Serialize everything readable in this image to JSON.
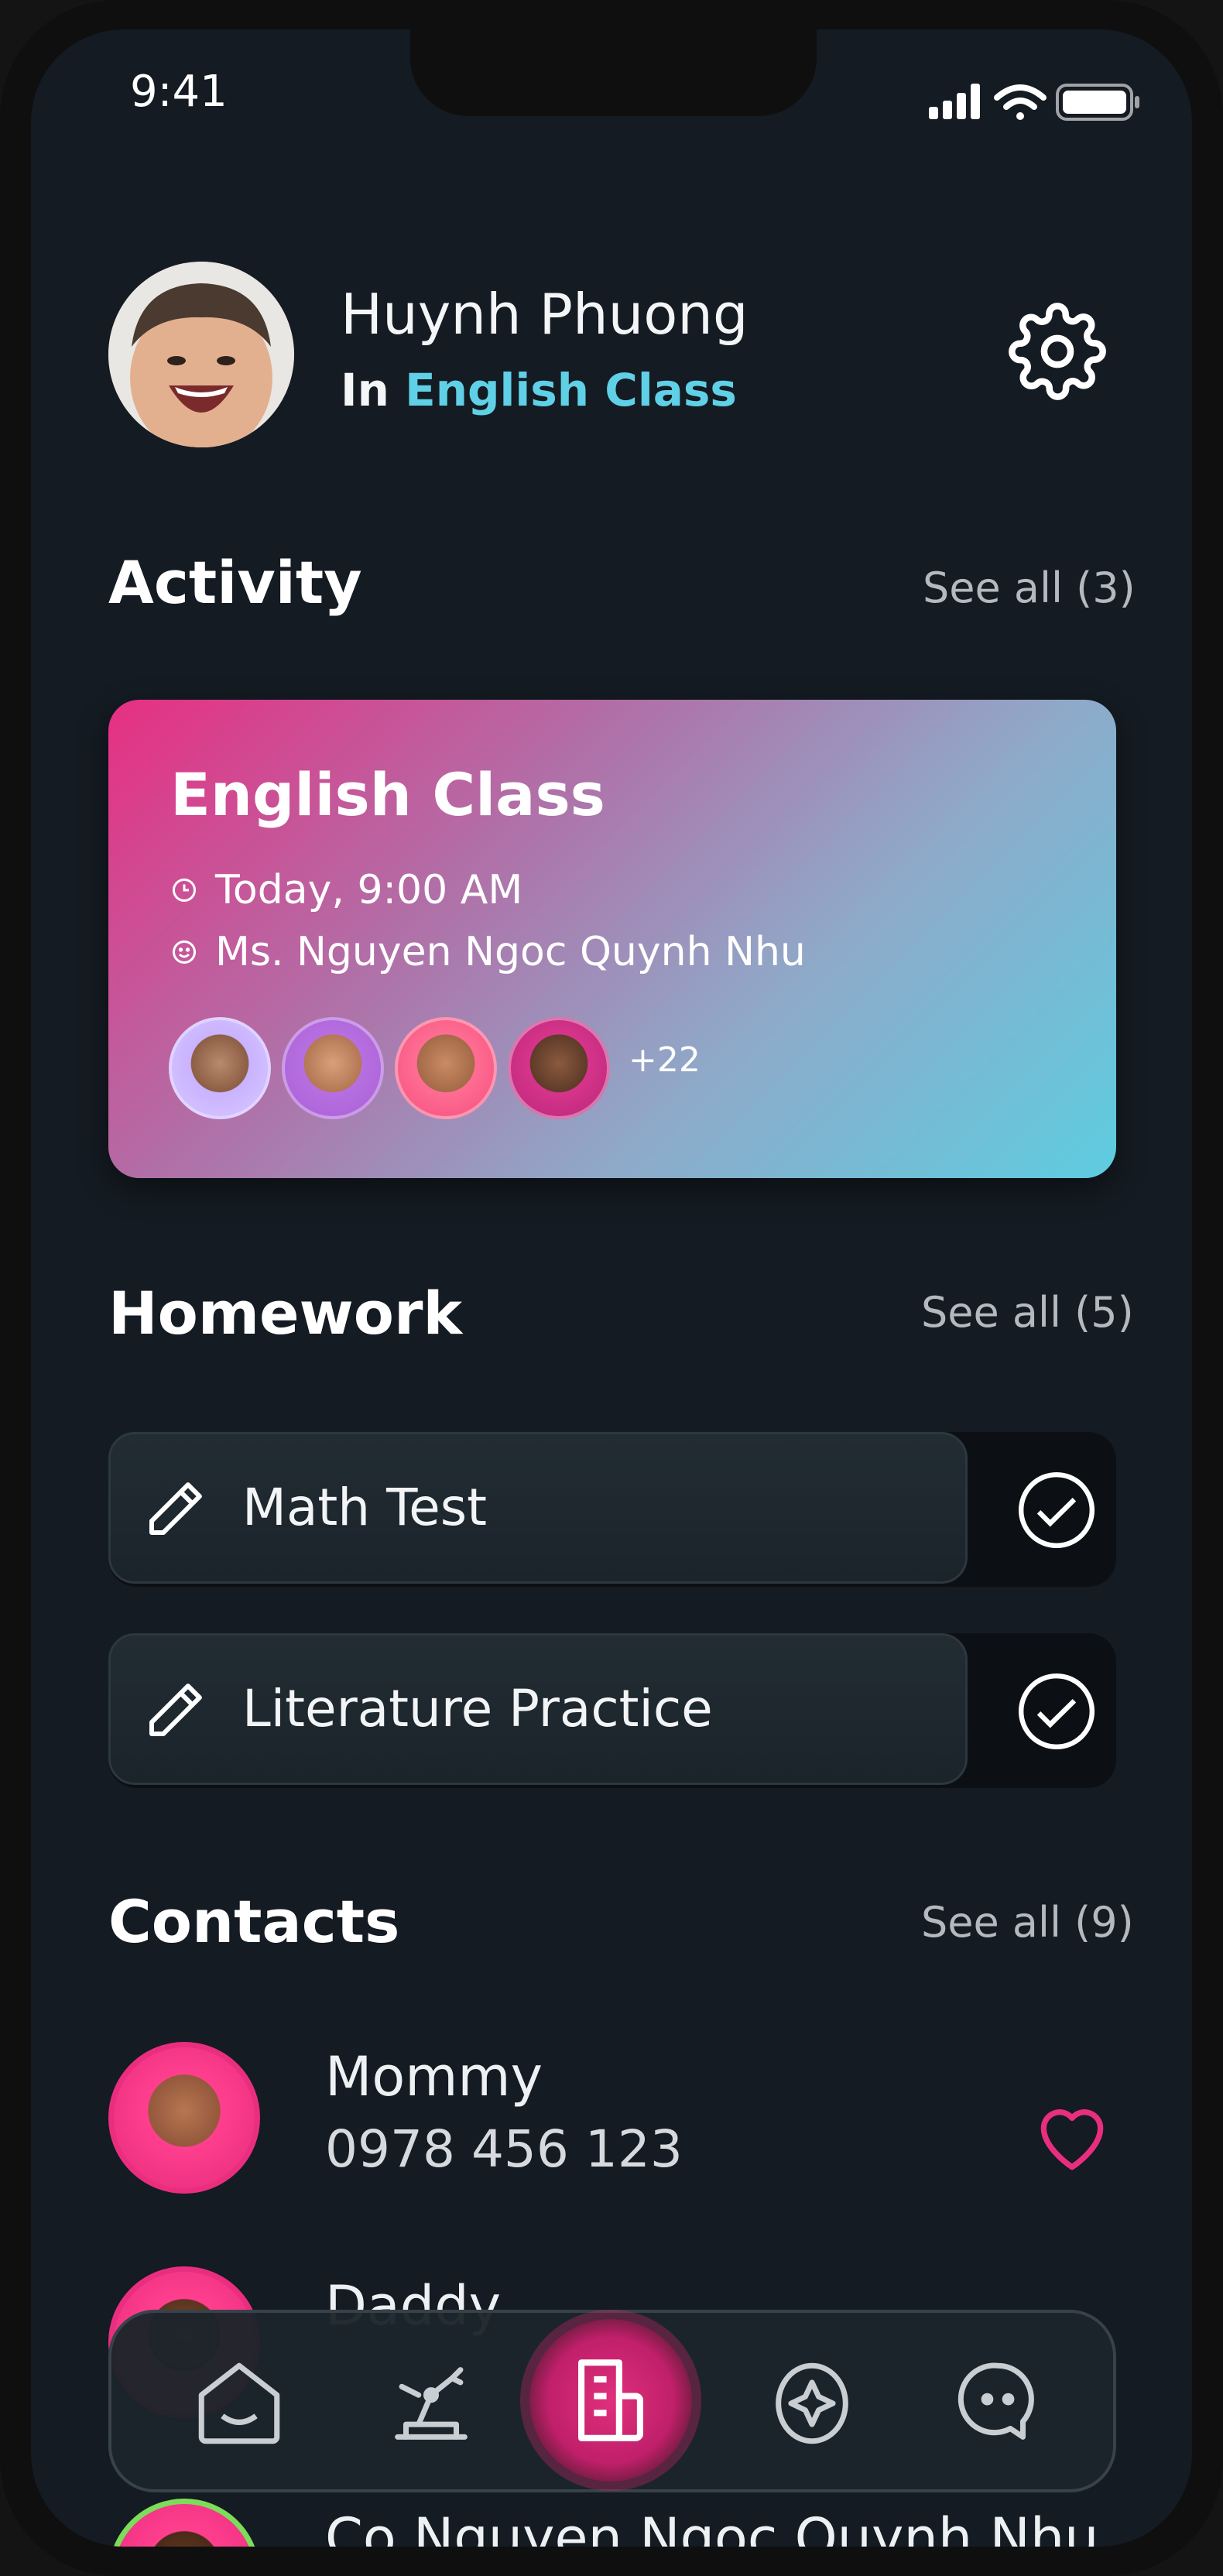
{
  "status_bar": {
    "time": "9:41"
  },
  "profile": {
    "name": "Huynh Phuong",
    "class_prefix": "In",
    "class_name": "English Class"
  },
  "activity": {
    "title": "Activity",
    "see_all": "See all (3)",
    "card": {
      "title": "English Class",
      "time": "Today, 9:00 AM",
      "teacher": "Ms. Nguyen Ngoc Quynh Nhu",
      "extra_members": "+22"
    }
  },
  "homework": {
    "title": "Homework",
    "see_all": "See all (5)",
    "items": [
      {
        "label": "Math Test"
      },
      {
        "label": "Literature Practice"
      }
    ]
  },
  "contacts": {
    "title": "Contacts",
    "see_all": "See all (9)",
    "items": [
      {
        "name": "Mommy",
        "phone": "0978 456 123"
      },
      {
        "name": "Daddy"
      },
      {
        "name": "Co Nguyen Ngoc Quynh Nhu"
      }
    ]
  },
  "colors": {
    "accent_cyan": "#5fd0e6",
    "accent_pink": "#ea2e7f",
    "background": "#141b22"
  },
  "nav": {
    "items": [
      "home-icon",
      "robot-arm-icon",
      "document-icon",
      "compass-icon",
      "chat-icon"
    ],
    "active": "document-icon"
  }
}
